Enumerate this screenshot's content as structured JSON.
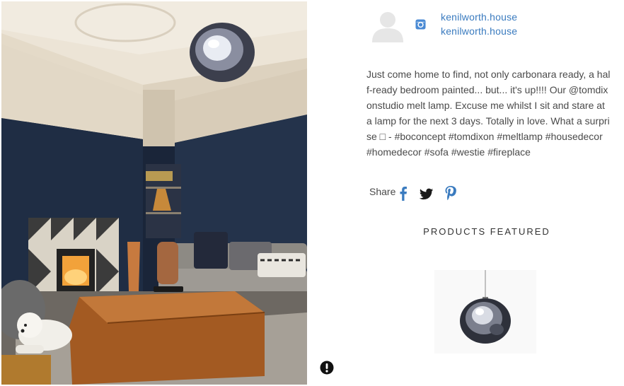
{
  "post": {
    "image_alt": "Living room with dark navy walls, a wood burning fireplace, leather ottoman, grey sofa, a white westie dog and a chrome melt pendant lamp",
    "author": {
      "handle_primary": "kenilworth.house",
      "handle_secondary": "kenilworth.house",
      "source_icon": "instagram-icon"
    },
    "caption": "Just come home to find, not only carbonara ready, a half-ready bedroom painted... but... it's up!!!! Our @tomdixonstudio melt lamp. Excuse me whilst I sit and stare at a lamp for the next 3 days. Totally in love. What a surprise □ - #boconcept #tomdixon #meltlamp #housedecor #homedecor #sofa #westie #fireplace"
  },
  "share": {
    "label": "Share",
    "icons": [
      "facebook-icon",
      "twitter-icon",
      "pinterest-icon"
    ]
  },
  "products": {
    "title": "PRODUCTS FEATURED",
    "items": [
      {
        "image": "melt-pendant-lamp-chrome"
      }
    ]
  },
  "colors": {
    "link": "#3a7bbf",
    "text": "#4a4a4a",
    "wall": "#1f2d44"
  }
}
